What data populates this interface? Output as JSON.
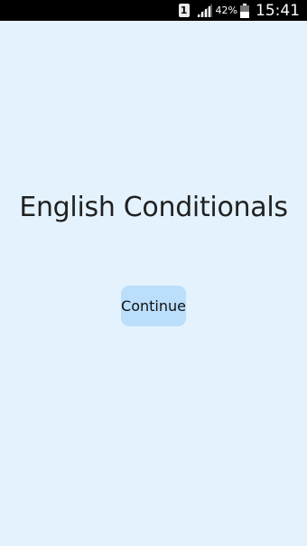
{
  "status_bar": {
    "sim_slot": "1",
    "battery_percent": "42%",
    "time": "15:41"
  },
  "main": {
    "title": "English Conditionals",
    "continue_label": "Continue"
  },
  "colors": {
    "background": "#e3f2fd",
    "button": "#bbdefb",
    "status_bar": "#000000"
  }
}
